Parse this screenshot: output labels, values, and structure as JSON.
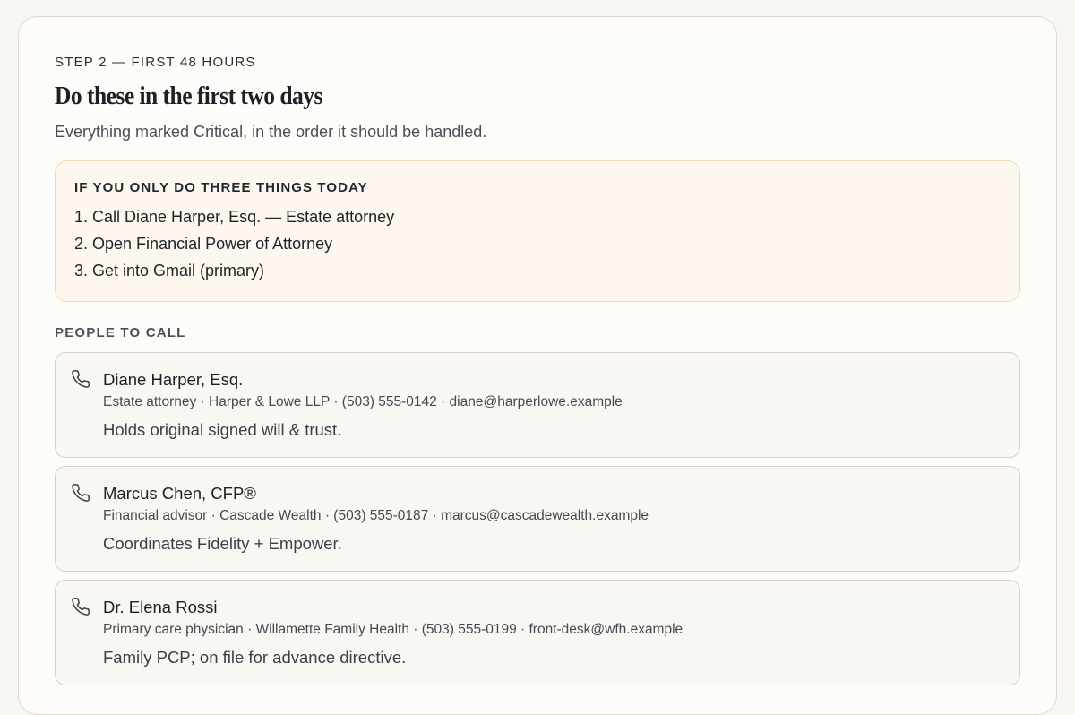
{
  "header": {
    "eyebrow": "STEP 2 — FIRST 48 HOURS",
    "title": "Do these in the first two days",
    "subtitle": "Everything marked Critical, in the order it should be handled."
  },
  "callout": {
    "heading": "IF YOU ONLY DO THREE THINGS TODAY",
    "items": [
      "1. Call Diane Harper, Esq. — Estate attorney",
      "2. Open Financial Power of Attorney",
      "3. Get into Gmail (primary)"
    ]
  },
  "people": {
    "label": "PEOPLE TO CALL",
    "contacts": [
      {
        "icon": "phone-icon",
        "name": "Diane Harper, Esq.",
        "meta": "Estate attorney · Harper & Lowe LLP · (503) 555-0142 · diane@harperlowe.example",
        "note": "Holds original signed will & trust."
      },
      {
        "icon": "phone-icon",
        "name": "Marcus Chen, CFP®",
        "meta": "Financial advisor · Cascade Wealth · (503) 555-0187 · marcus@cascadewealth.example",
        "note": "Coordinates Fidelity + Empower."
      },
      {
        "icon": "phone-icon",
        "name": "Dr. Elena Rossi",
        "meta": "Primary care physician · Willamette Family Health · (503) 555-0199 · front-desk@wfh.example",
        "note": "Family PCP; on file for advance directive."
      }
    ]
  },
  "colors": {
    "page_background": "#f8f6f1",
    "callout_background": "#fdf7f0",
    "callout_border": "#efd9bd",
    "contact_border": "#d6d2c9"
  }
}
